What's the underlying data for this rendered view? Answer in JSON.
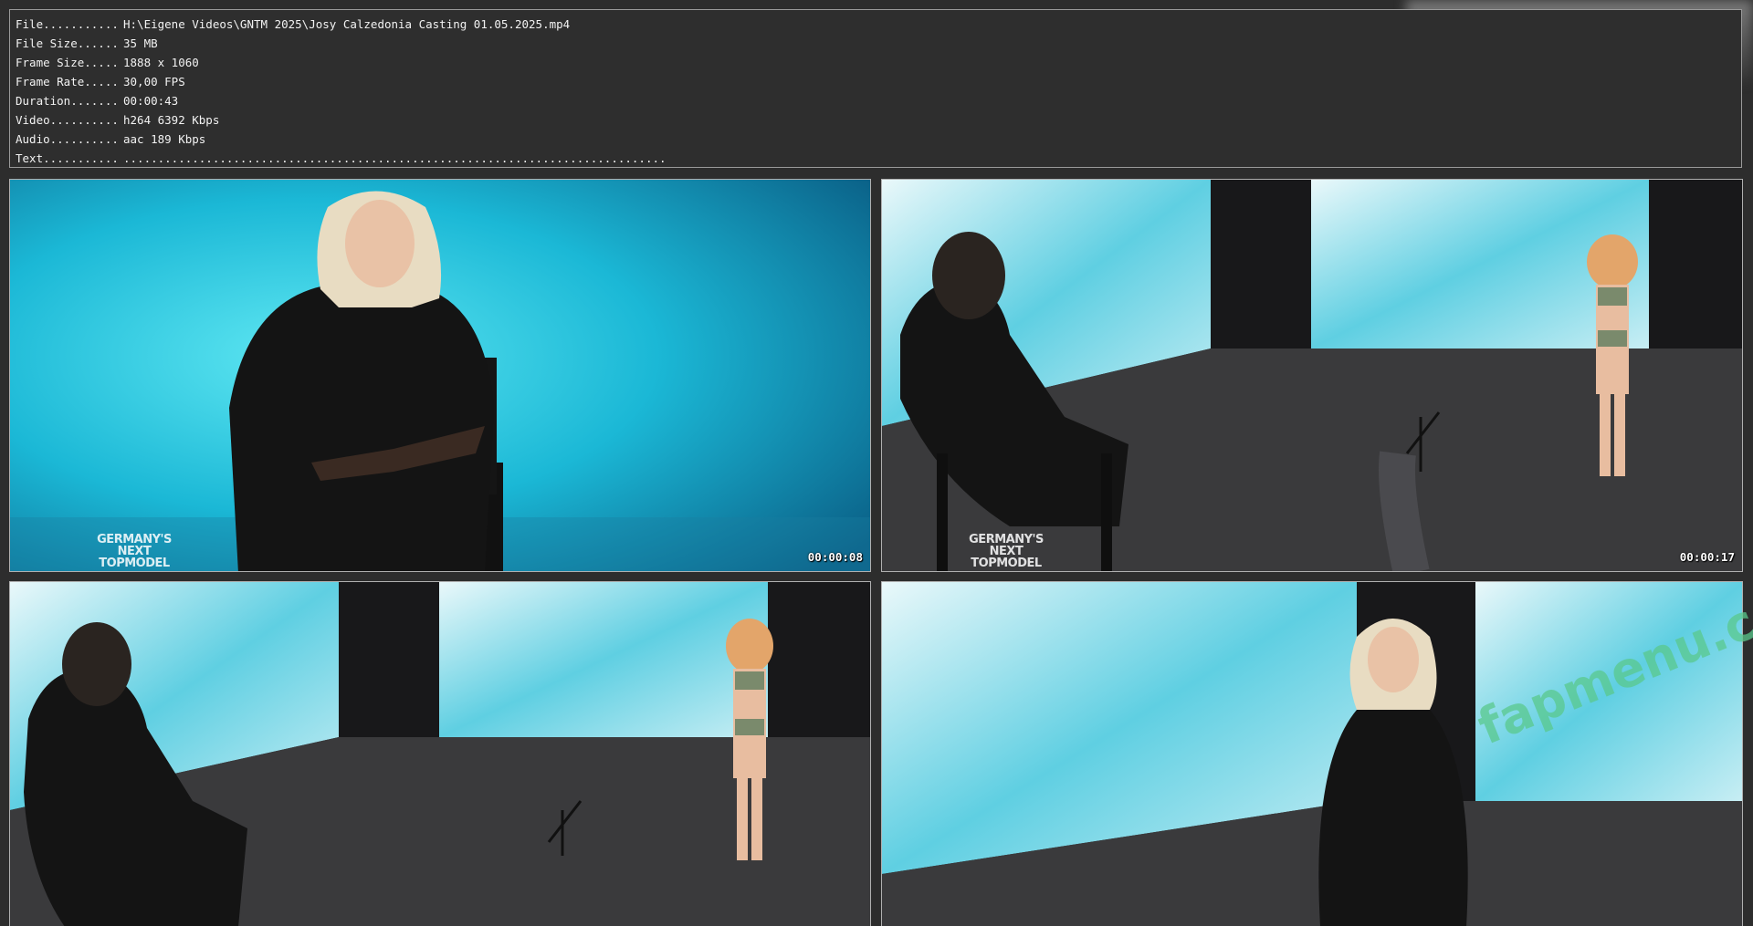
{
  "info": {
    "rows": [
      {
        "label": "File...........",
        "value": "H:\\Eigene Videos\\GNTM 2025\\Josy Calzedonia Casting 01.05.2025.mp4"
      },
      {
        "label": "File Size......",
        "value": "35 MB"
      },
      {
        "label": "Frame Size.....",
        "value": "1888 x 1060"
      },
      {
        "label": "Frame Rate.....",
        "value": "30,00 FPS"
      },
      {
        "label": "Duration.......",
        "value": "00:00:43"
      },
      {
        "label": "Video..........",
        "value": "h264 6392 Kbps"
      },
      {
        "label": "Audio..........",
        "value": "aac 189 Kbps"
      },
      {
        "label": "Text...........",
        "value": "..............................................................................."
      }
    ]
  },
  "thumbnails": [
    {
      "timestamp": "00:00:08",
      "logo": "GERMANY'S NEXT TOPMODEL"
    },
    {
      "timestamp": "00:00:17",
      "logo": "GERMANY'S NEXT TOPMODEL"
    },
    {
      "timestamp": "",
      "logo": ""
    },
    {
      "timestamp": "",
      "logo": ""
    }
  ],
  "watermark": "fapmenu.com",
  "colors": {
    "background": "#2d2d2d",
    "panel_border": "#9a9a9a",
    "text": "#f2f2f2",
    "screen_cyan": "#1ec8de",
    "floor": "#3a3a3c"
  }
}
